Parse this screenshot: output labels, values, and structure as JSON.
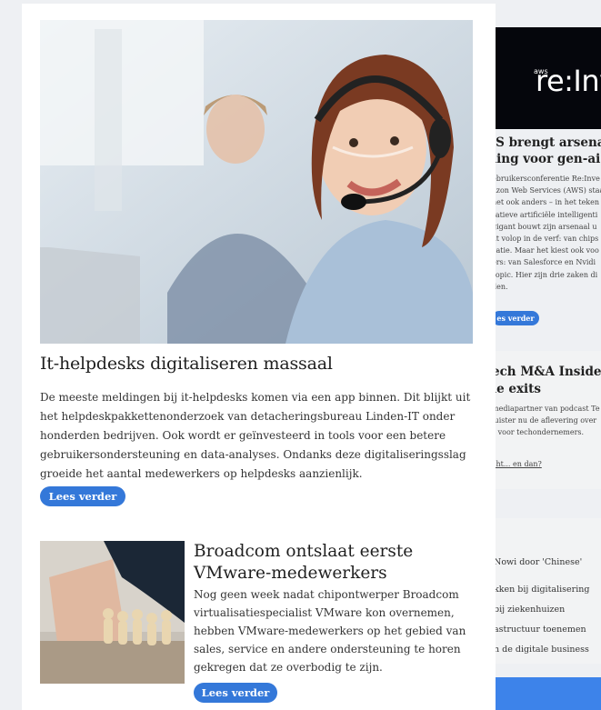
{
  "hero": {
    "title": "It-helpdesks digitaliseren massaal",
    "text": "De meeste meldingen bij it-helpdesks komen via een app binnen. Dit blijkt uit het helpdeskpakkettenonderzoek van detacheringsbureau Linden-IT onder honderden bedrijven. Ook wordt er geïnvesteerd in tools voor een betere gebruikersondersteuning en data-analyses. Ondanks deze digitaliseringsslag groeide het aantal medewerkers op helpdesks aanzienlijk.",
    "button": "Lees verder"
  },
  "article2": {
    "title": "Broadcom ontslaat eerste VMware-medewerkers",
    "text": "Nog geen week nadat chipontwerper Broadcom virtualisatiespecialist VMware kon overnemen, hebben VMware-medewerkers op het gebied van sales, service en andere ondersteuning te horen gekregen dat ze overbodig te zijn.",
    "button": "Lees verder"
  },
  "right": {
    "image_small": "aws",
    "image_text": "re:Inve",
    "title": "'S brengt arsenaal\nling voor gen-ai-ra",
    "text": "ebruikersconferentie Re:Inve\nazon Web Services (AWS) staa\nhet ook anders – in het teken\nratieve artificiële intelligenti\ngigant bouwt zijn arsenaal u\nat volop in de verf: van chips\ncatie. Maar het kiest ook voo\ners: van Salesforce en Nvidi\nropic. Hier zijn drie zaken di\nden.",
    "button": "es verder",
    "box1_title": "ech M&A Insider:\nle exits",
    "box1_text": "mediapartner van podcast Te\nluister nu de aflevering over\ns voor techondernemers.",
    "box1_link": "cht... en dan?",
    "list": [
      "Nowi door 'Chinese'",
      "kken bij digitalisering",
      "bij ziekenhuizen",
      "astructuur toenemen",
      "n de digitale business"
    ]
  }
}
